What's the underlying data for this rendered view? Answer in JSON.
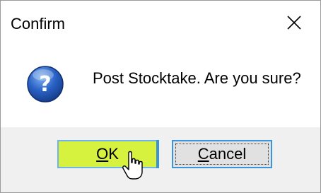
{
  "dialog": {
    "title": "Confirm",
    "message": "Post Stocktake. Are you sure?",
    "icon": "question-icon",
    "buttons": {
      "ok": {
        "accel": "O",
        "rest": "K"
      },
      "cancel": {
        "accel": "C",
        "rest": "ancel"
      }
    }
  },
  "colors": {
    "ok_highlight": "#d6f23e",
    "focus_border": "#3c94d8",
    "icon_blue": "#1d4fa8"
  }
}
